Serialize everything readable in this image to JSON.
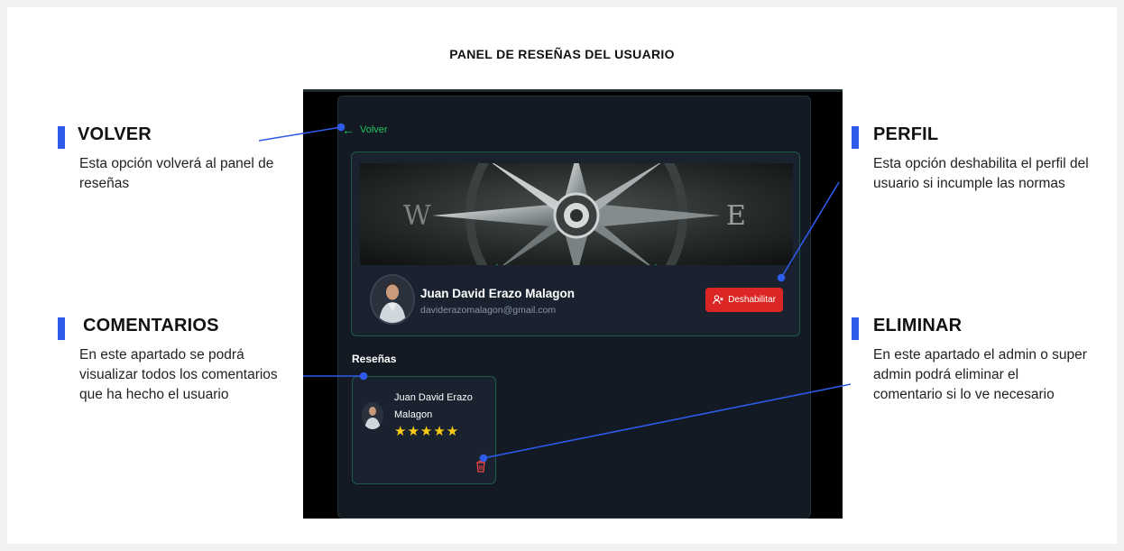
{
  "slide": {
    "title": "PANEL DE RESEÑAS DEL USUARIO"
  },
  "notes": {
    "volver": {
      "title": "VOLVER",
      "text": "Esta opción volverá al panel de reseñas"
    },
    "comentarios": {
      "title": "COMENTARIOS",
      "text": "En este apartado se podrá visualizar todos los comentarios que ha hecho el usuario"
    },
    "perfil": {
      "title": "PERFIL",
      "text": "Esta opción deshabilita el perfil del usuario si incumple las normas"
    },
    "eliminar": {
      "title": "ELIMINAR",
      "text": "En este apartado el admin o super admin podrá eliminar el comentario si lo ve necesario"
    }
  },
  "app": {
    "back_label": "Volver",
    "banner_letters": {
      "west": "W",
      "east": "E"
    },
    "profile": {
      "name": "Juan David Erazo Malagon",
      "email": "daviderazomalagon@gmail.com",
      "disable_label": "Deshabilitar"
    },
    "reviews_heading": "Reseñas",
    "reviews": [
      {
        "author": "Juan David Erazo Malagon",
        "stars": "★★★★★",
        "rating": 5
      }
    ]
  },
  "colors": {
    "accent_blue": "#2f5bea",
    "back_green": "#22c55e",
    "danger_red": "#dc2626",
    "star_yellow": "#facc15",
    "panel_bg": "#141a24"
  },
  "icons": {
    "back": "arrow-left-icon",
    "disable": "user-x-icon",
    "delete": "trash-icon"
  }
}
